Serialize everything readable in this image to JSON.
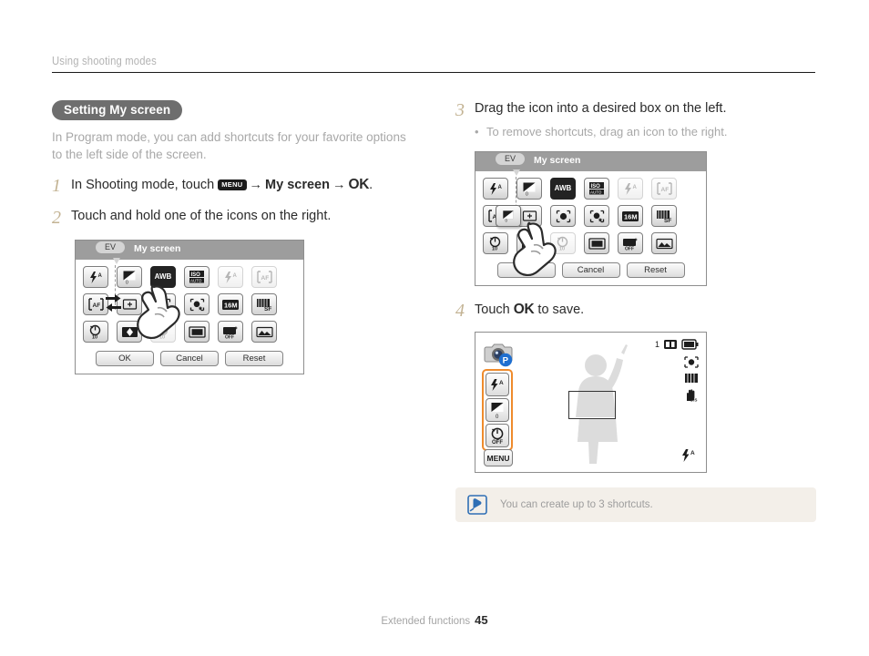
{
  "running_head": "Using shooting modes",
  "section": {
    "pill_label": "Setting My screen",
    "intro": "In Program mode, you can add shortcuts for your favorite options to the left side of the screen."
  },
  "steps": [
    {
      "num": "1",
      "prefix": "In Shooting mode, touch ",
      "menu_badge": "MENU",
      "arrow1": "→",
      "target": "My screen",
      "arrow2": "→",
      "ok": "OK",
      "suffix": "."
    },
    {
      "num": "2",
      "text": "Touch and hold one of the icons on the right."
    },
    {
      "num": "3",
      "text": "Drag the icon into a desired box on the left.",
      "bullet": "To remove shortcuts, drag an icon to the right.",
      "bullet_dot": "•"
    },
    {
      "num": "4",
      "prefix": "Touch ",
      "ok": "OK",
      "suffix": " to save."
    }
  ],
  "myscreen_dialog": {
    "ev_tooltip": "EV",
    "title": "My screen",
    "buttons": [
      "OK",
      "Cancel",
      "Reset"
    ],
    "grid": {
      "left_column": [
        "flash-auto",
        "af-bracket",
        "timer-10"
      ],
      "rows": [
        [
          "ev-compensation",
          "awb-white-balance",
          "iso-auto",
          "flash-auto-dim",
          "af-bracket-dim"
        ],
        [
          "focus-point",
          "face-detect-star",
          "face-detect-smile",
          "16m-resolution",
          "sf-quality"
        ],
        [
          "multi-frame",
          "timer-10-dim",
          "frame-mode",
          "photo-off",
          "landscape"
        ]
      ]
    }
  },
  "preview_screen": {
    "mode_badge": "P",
    "shortcut_icons": [
      "flash-auto",
      "ev-zero",
      "timer-off"
    ],
    "menu_label": "MENU",
    "shots_remaining": "1",
    "status_icons": [
      "memory-card",
      "battery-full",
      "face-detect",
      "sf-quality",
      "ois-hand"
    ],
    "ev_value": "0",
    "timer_value": "OFF",
    "flash_value": "A"
  },
  "note": {
    "icon": "note-pen-icon",
    "text": "You can create up to 3 shortcuts."
  },
  "footer": {
    "label": "Extended functions",
    "page": "45"
  },
  "colors": {
    "accent_orange": "#ef8b2c",
    "step_number": "#c3b393",
    "pill_bg": "#6e6e6e",
    "title_bar": "#9d9d9d",
    "note_bg": "#f3efe9"
  }
}
